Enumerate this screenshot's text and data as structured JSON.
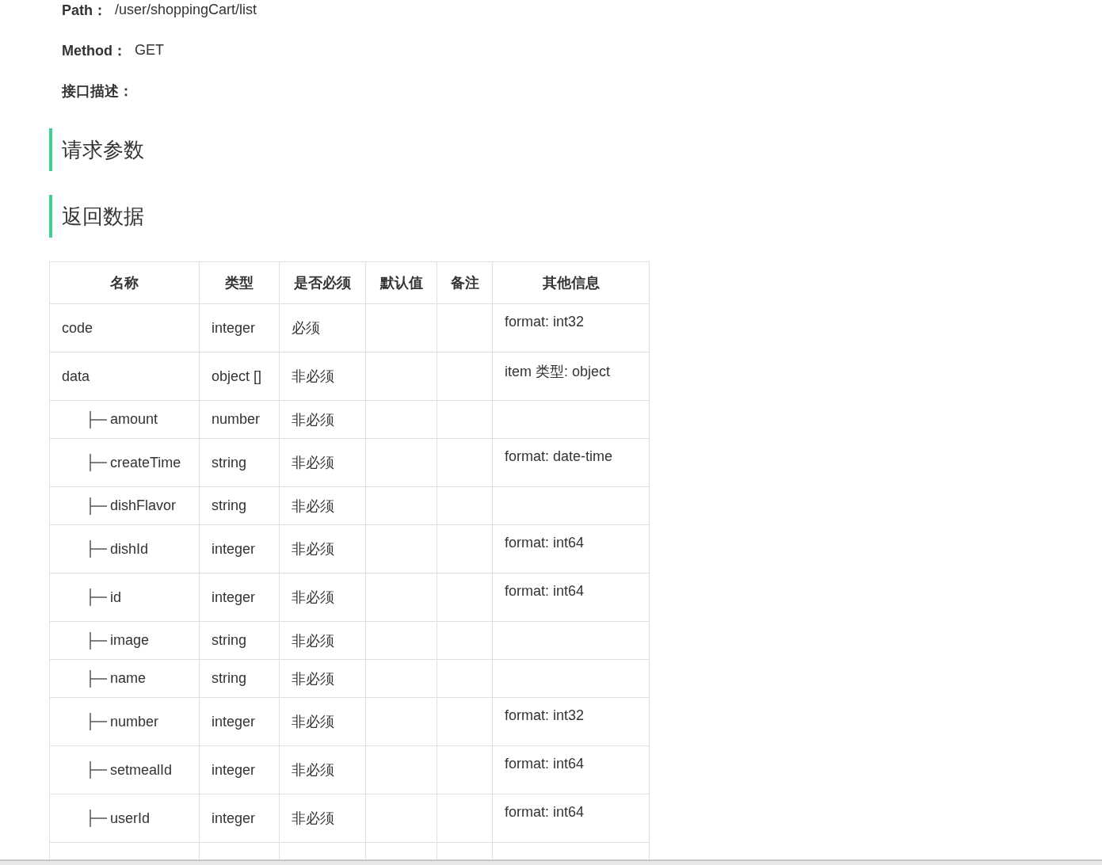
{
  "info": [
    {
      "label": "Path：",
      "value": "/user/shoppingCart/list"
    },
    {
      "label": "Method：",
      "value": "GET"
    },
    {
      "label": "接口描述："
    }
  ],
  "sections": [
    {
      "title": "请求参数"
    },
    {
      "title": "返回数据"
    }
  ],
  "table": {
    "columns": [
      "名称",
      "类型",
      "是否必须",
      "默认值",
      "备注",
      "其他信息"
    ],
    "rows": [
      {
        "name": "code",
        "type": "integer",
        "required": "必须",
        "other": "format: int32"
      },
      {
        "name": "data",
        "type": "object []",
        "required": "非必须",
        "other": "item 类型: object",
        "children": [
          {
            "name": "amount",
            "type": "number",
            "required": "非必须"
          },
          {
            "name": "createTime",
            "type": "string",
            "required": "非必须",
            "other": "format: date-time"
          },
          {
            "name": "dishFlavor",
            "type": "string",
            "required": "非必须"
          },
          {
            "name": "dishId",
            "type": "integer",
            "required": "非必须",
            "other": "format: int64"
          },
          {
            "name": "id",
            "type": "integer",
            "required": "非必须",
            "other": "format: int64"
          },
          {
            "name": "image",
            "type": "string",
            "required": "非必须"
          },
          {
            "name": "name",
            "type": "string",
            "required": "非必须"
          },
          {
            "name": "number",
            "type": "integer",
            "required": "非必须",
            "other": "format: int32"
          },
          {
            "name": "setmealId",
            "type": "integer",
            "required": "非必须",
            "other": "format: int64"
          },
          {
            "name": "userId",
            "type": "integer",
            "required": "非必须",
            "other": "format: int64"
          }
        ]
      }
    ]
  }
}
